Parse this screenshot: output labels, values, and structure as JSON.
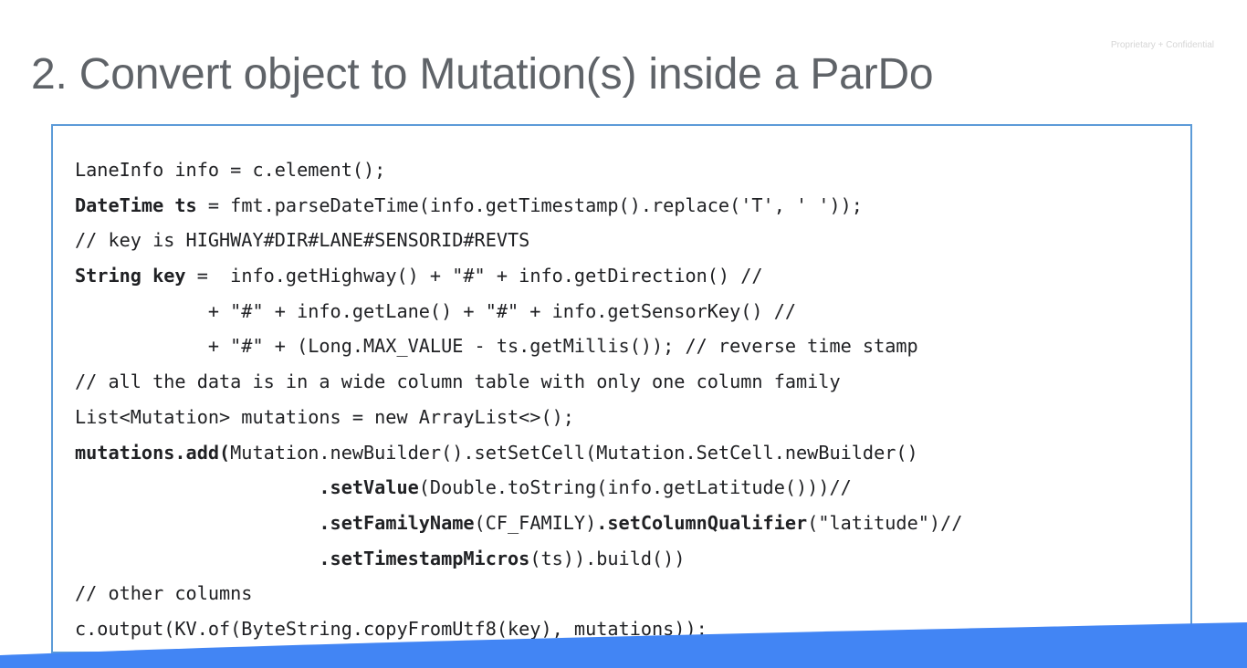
{
  "slide": {
    "confidential_label": "Proprietary + Confidential",
    "title": "2. Convert object to Mutation(s) inside a ParDo"
  },
  "code_lines": [
    [
      {
        "t": "LaneInfo info = c.element();",
        "b": false
      }
    ],
    [
      {
        "t": "DateTime ts",
        "b": true
      },
      {
        "t": " = fmt.parseDateTime(info.getTimestamp().replace('T', ' '));",
        "b": false
      }
    ],
    [
      {
        "t": "// key is HIGHWAY#DIR#LANE#SENSORID#REVTS",
        "b": false
      }
    ],
    [
      {
        "t": "String key",
        "b": true
      },
      {
        "t": " =  info.getHighway() + \"#\" + info.getDirection() //",
        "b": false
      }
    ],
    [
      {
        "t": "            + \"#\" + info.getLane() + \"#\" + info.getSensorKey() //",
        "b": false
      }
    ],
    [
      {
        "t": "            + \"#\" + (Long.MAX_VALUE - ts.getMillis()); // reverse time stamp",
        "b": false
      }
    ],
    [
      {
        "t": "// all the data is in a wide column table with only one column family",
        "b": false
      }
    ],
    [
      {
        "t": "List<Mutation> mutations = new ArrayList<>();",
        "b": false
      }
    ],
    [
      {
        "t": "mutations.add(",
        "b": true
      },
      {
        "t": "Mutation.newBuilder().setSetCell(Mutation.SetCell.newBuilder()",
        "b": false
      }
    ],
    [
      {
        "t": "                      ",
        "b": false
      },
      {
        "t": ".setValue",
        "b": true
      },
      {
        "t": "(Double.toString(info.getLatitude()))//",
        "b": false
      }
    ],
    [
      {
        "t": "                      ",
        "b": false
      },
      {
        "t": ".setFamilyName",
        "b": true
      },
      {
        "t": "(CF_FAMILY)",
        "b": false
      },
      {
        "t": ".setColumnQualifier",
        "b": true
      },
      {
        "t": "(\"latitude\")//",
        "b": false
      }
    ],
    [
      {
        "t": "                      ",
        "b": false
      },
      {
        "t": ".setTimestampMicros",
        "b": true
      },
      {
        "t": "(ts)).build())",
        "b": false
      }
    ],
    [
      {
        "t": "// other columns",
        "b": false
      }
    ],
    [
      {
        "t": "c.output(KV.of(ByteString.copyFromUtf8(key), mutations));",
        "b": false
      }
    ]
  ],
  "colors": {
    "title": "#5f6368",
    "code_box_border": "#5c9bd8",
    "bottom_band": "#4285f4"
  }
}
